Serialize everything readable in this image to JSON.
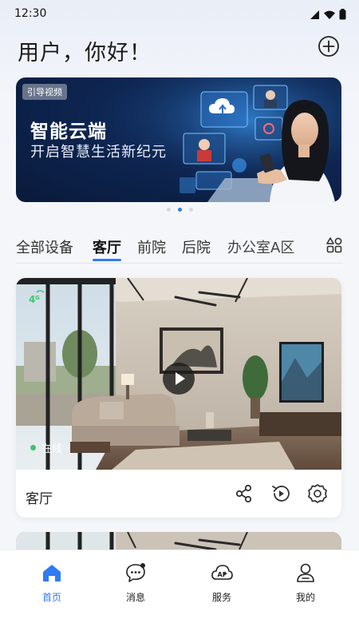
{
  "status_bar": {
    "time": "12:30"
  },
  "header": {
    "greeting": "用户，你好！"
  },
  "banner": {
    "tag": "引导视频",
    "title": "智能云端",
    "subtitle": "开启智慧生活新纪元",
    "page_count": 3,
    "active_page": 2
  },
  "tabs": {
    "items": [
      "全部设备",
      "客厅",
      "前院",
      "后院",
      "办公室A区"
    ],
    "active": "客厅"
  },
  "device_card": {
    "network_badge": "4G",
    "status": "在线",
    "name": "客厅"
  },
  "bottom_nav": {
    "items": [
      {
        "label": "首页",
        "icon": "home-icon",
        "active": true
      },
      {
        "label": "消息",
        "icon": "message-icon",
        "active": false
      },
      {
        "label": "服务",
        "icon": "ai-service-icon",
        "active": false
      },
      {
        "label": "我的",
        "icon": "profile-icon",
        "active": false
      }
    ]
  },
  "colors": {
    "accent": "#2f7bf5",
    "online": "#3cc66a"
  }
}
